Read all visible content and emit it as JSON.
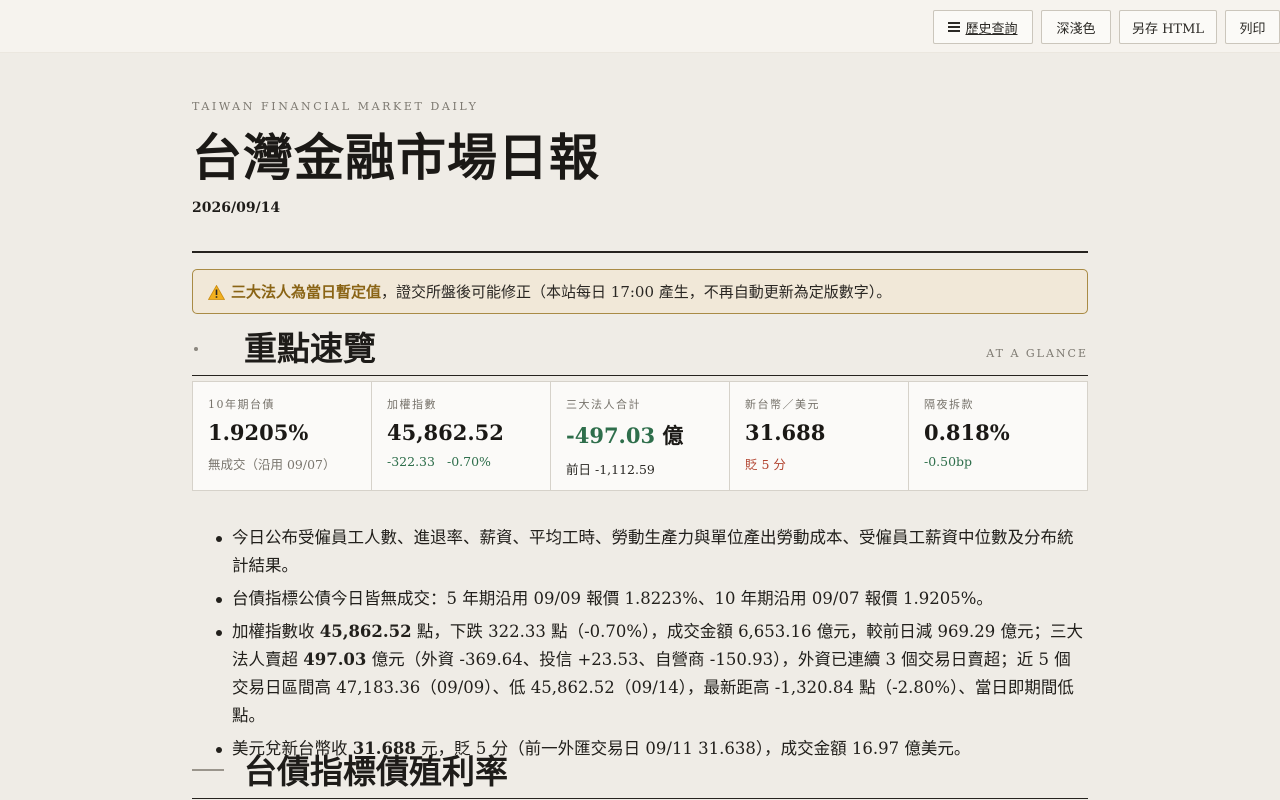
{
  "toolbar": {
    "history_label": "歷史查詢",
    "theme_label": "深淺色",
    "save_label": "另存 HTML",
    "print_label": "列印"
  },
  "header": {
    "kicker": "TAIWAN FINANCIAL MARKET DAILY",
    "title": "台灣金融市場日報",
    "date": "2026/09/14"
  },
  "notice": {
    "emphasis": "三大法人為當日暫定值",
    "text": "，證交所盤後可能修正（本站每日 17:00 產生，不再自動更新為定版數字）。"
  },
  "glance": {
    "title": "重點速覽",
    "eng": "AT A GLANCE",
    "cards": [
      {
        "label": "10年期台債",
        "value": "1.9205%",
        "sub": "無成交（沿用 09/07）"
      },
      {
        "label": "加權指數",
        "value": "45,862.52",
        "sub_a": "-322.33",
        "sub_b": "-0.70%"
      },
      {
        "label": "三大法人合計",
        "value": "-497.03",
        "unit": "億",
        "sub": "前日 -1,112.59"
      },
      {
        "label": "新台幣／美元",
        "value": "31.688",
        "sub": "貶 5 分"
      },
      {
        "label": "隔夜拆款",
        "value": "0.818%",
        "sub": "-0.50bp"
      }
    ]
  },
  "bullets": [
    {
      "text": "今日公布受僱員工人數、進退率、薪資、平均工時、勞動生產力與單位產出勞動成本、受僱員工薪資中位數及分布統計結果。"
    },
    {
      "text": "台債指標公債今日皆無成交：5 年期沿用 09/09 報價 1.8223%、10 年期沿用 09/07 報價 1.9205%。"
    },
    {
      "pre": "加權指數收 ",
      "b1": "45,862.52",
      "mid": " 點，下跌 322.33 點（-0.70%），成交金額 6,653.16 億元，較前日減 969.29 億元；三大法人賣超 ",
      "b2": "497.03",
      "post": " 億元（外資 -369.64、投信 +23.53、自營商 -150.93），外資已連續 3 個交易日賣超；近 5 個交易日區間高 47,183.36（09/09）、低 45,862.52（09/14），最新距高 -1,320.84 點（-2.80%）、當日即期間低點。"
    },
    {
      "pre": "美元兌新台幣收 ",
      "b1": "31.688",
      "post": " 元，貶 5 分（前一外匯交易日 09/11 31.638），成交金額 16.97 億美元。"
    }
  ],
  "yield_section": {
    "title": "台債指標債殖利率"
  },
  "colors": {
    "accent_green": "#2e6e4b",
    "accent_red": "#b2432f",
    "notice_border": "#a98b45",
    "notice_emphasis": "#8a6415"
  }
}
